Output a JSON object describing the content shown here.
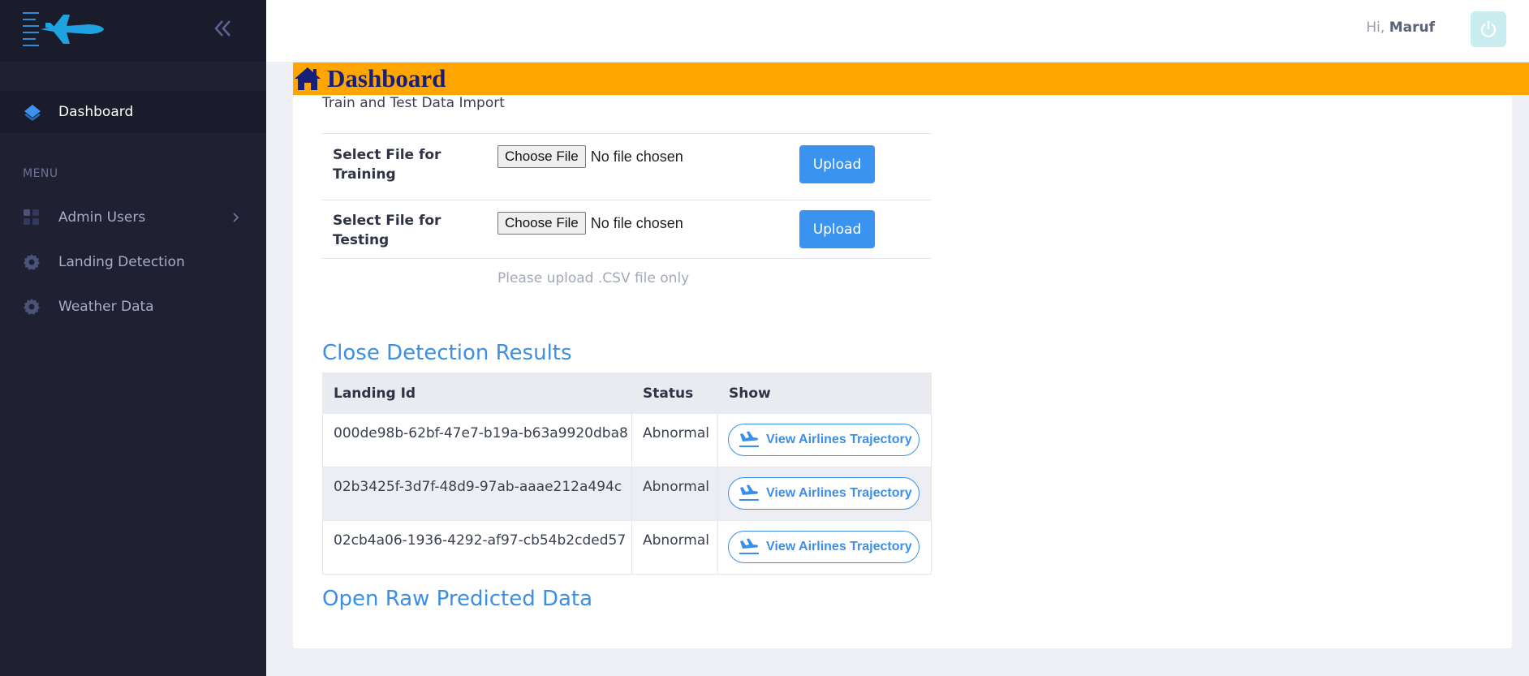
{
  "sidebar": {
    "logo": "airplane-logo",
    "dashboard_label": "Dashboard",
    "menu_heading": "MENU",
    "items": [
      {
        "label": "Admin Users",
        "icon": "grid-icon"
      },
      {
        "label": "Landing Detection",
        "icon": "gear-icon"
      },
      {
        "label": "Weather Data",
        "icon": "gear-icon"
      }
    ]
  },
  "header": {
    "greeting_prefix": "Hi,",
    "user_name": "Maruf"
  },
  "page": {
    "title": "Dashboard",
    "import_heading": "Train and Test Data Import",
    "upload_rows": [
      {
        "label": "Select File for Training",
        "choose_label": "Choose File",
        "status": "No file chosen",
        "button": "Upload"
      },
      {
        "label": "Select File for Testing",
        "choose_label": "Choose File",
        "status": "No file chosen",
        "button": "Upload"
      }
    ],
    "hint": "Please upload .CSV file only"
  },
  "results": {
    "title": "Close Detection Results",
    "columns": [
      "Landing Id",
      "Status",
      "Show"
    ],
    "rows": [
      {
        "id": "000de98b-62bf-47e7-b19a-b63a9920dba8",
        "status": "Abnormal",
        "action": "View Airlines Trajectory"
      },
      {
        "id": "02b3425f-3d7f-48d9-97ab-aaae212a494c",
        "status": "Abnormal",
        "action": "View Airlines Trajectory"
      },
      {
        "id": "02cb4a06-1936-4292-af97-cb54b2cded57",
        "status": "Abnormal",
        "action": "View Airlines Trajectory"
      }
    ]
  },
  "raw_section_title": "Open Raw Predicted Data",
  "colors": {
    "sidebar_bg": "#1f2032",
    "banner_bg": "#ffa500",
    "banner_text": "#16207a",
    "accent": "#3b93f0"
  }
}
